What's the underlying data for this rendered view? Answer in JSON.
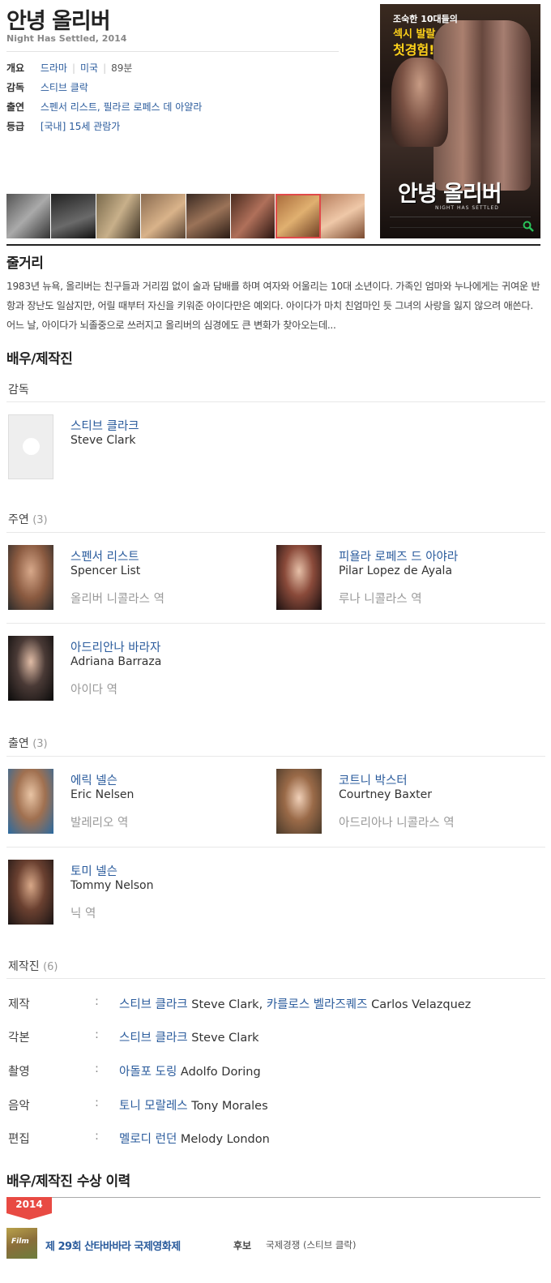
{
  "movie": {
    "title": "안녕 올리버",
    "subtitle": "Night Has Settled, 2014",
    "info": {
      "overview_label": "개요",
      "genre": "드라마",
      "country": "미국",
      "runtime": "89분",
      "director_label": "감독",
      "director": "스티브 클락",
      "cast_label": "출연",
      "cast": "스펜서 리스트, 필라르 로페스 데 아얄라",
      "rating_label": "등급",
      "rating": "[국내] 15세 관람가"
    },
    "poster": {
      "tagline1": "조숙한 10대들의",
      "tagline2": "섹시 발랄",
      "tagline3": "첫경험!",
      "title": "안녕 올리버",
      "subtitle": "NIGHT HAS SETTLED",
      "zoom_icon": "search-icon"
    },
    "still_count": 8
  },
  "synopsis": {
    "heading": "줄거리",
    "text": "1983년 뉴욕, 올리버는 친구들과 거리낌 없이 술과 담배를 하며 여자와 어울리는 10대 소년이다. 가족인 엄마와 누나에게는 귀여운 반항과 장난도 일삼지만, 어릴 때부터 자신을 키워준 아이다만은 예외다. 아이다가 마치 친엄마인 듯 그녀의 사랑을 잃지 않으려 애쓴다. 어느 날, 아이다가 뇌졸중으로 쓰러지고 올리버의 심경에도 큰 변화가 찾아오는데..."
  },
  "cast_section": {
    "heading": "배우/제작진",
    "director_group": {
      "label": "감독",
      "people": [
        {
          "kname": "스티브 클라크",
          "ename": "Steve Clark",
          "photo": "no-image"
        }
      ]
    },
    "lead_group": {
      "label": "주연",
      "count": "(3)",
      "people": [
        {
          "kname": "스펜서 리스트",
          "ename": "Spencer List",
          "role": "올리버 니콜라스 역"
        },
        {
          "kname": "피욜라 로페즈 드 아야라",
          "ename": "Pilar Lopez de Ayala",
          "role": "루나 니콜라스 역"
        },
        {
          "kname": "아드리안나 바라자",
          "ename": "Adriana Barraza",
          "role": "아이다 역"
        }
      ]
    },
    "support_group": {
      "label": "출연",
      "count": "(3)",
      "people": [
        {
          "kname": "에릭 넬슨",
          "ename": "Eric Nelsen",
          "role": "발레리오 역"
        },
        {
          "kname": "코트니 박스터",
          "ename": "Courtney Baxter",
          "role": "아드리아나 니콜라스 역"
        },
        {
          "kname": "토미 넬슨",
          "ename": "Tommy Nelson",
          "role": "닉 역"
        }
      ]
    },
    "crew_group": {
      "label": "제작진",
      "count": "(6)",
      "colon": ":",
      "rows": [
        {
          "label": "제작",
          "links": [
            {
              "k": "스티브 클라크",
              "e": " Steve Clark, "
            },
            {
              "k": "카를로스 벨라즈퀘즈",
              "e": " Carlos Velazquez"
            }
          ]
        },
        {
          "label": "각본",
          "links": [
            {
              "k": "스티브 클라크",
              "e": " Steve Clark"
            }
          ]
        },
        {
          "label": "촬영",
          "links": [
            {
              "k": "아돌포 도링",
              "e": " Adolfo Doring"
            }
          ]
        },
        {
          "label": "음악",
          "links": [
            {
              "k": "토니 모랄레스",
              "e": " Tony Morales"
            }
          ]
        },
        {
          "label": "편집",
          "links": [
            {
              "k": "멜로디 런던",
              "e": " Melody London"
            }
          ]
        }
      ]
    }
  },
  "awards": {
    "heading": "배우/제작진 수상 이력",
    "year": "2014",
    "logo_text": "Film",
    "festival": "제 29회 산타바바라 국제영화제",
    "type": "후보",
    "category": "국제경쟁 (스티브 클락)"
  },
  "colors": {
    "link": "#2a5b9c",
    "badge": "#e84a43",
    "poster_accent": "#ffd21a"
  }
}
